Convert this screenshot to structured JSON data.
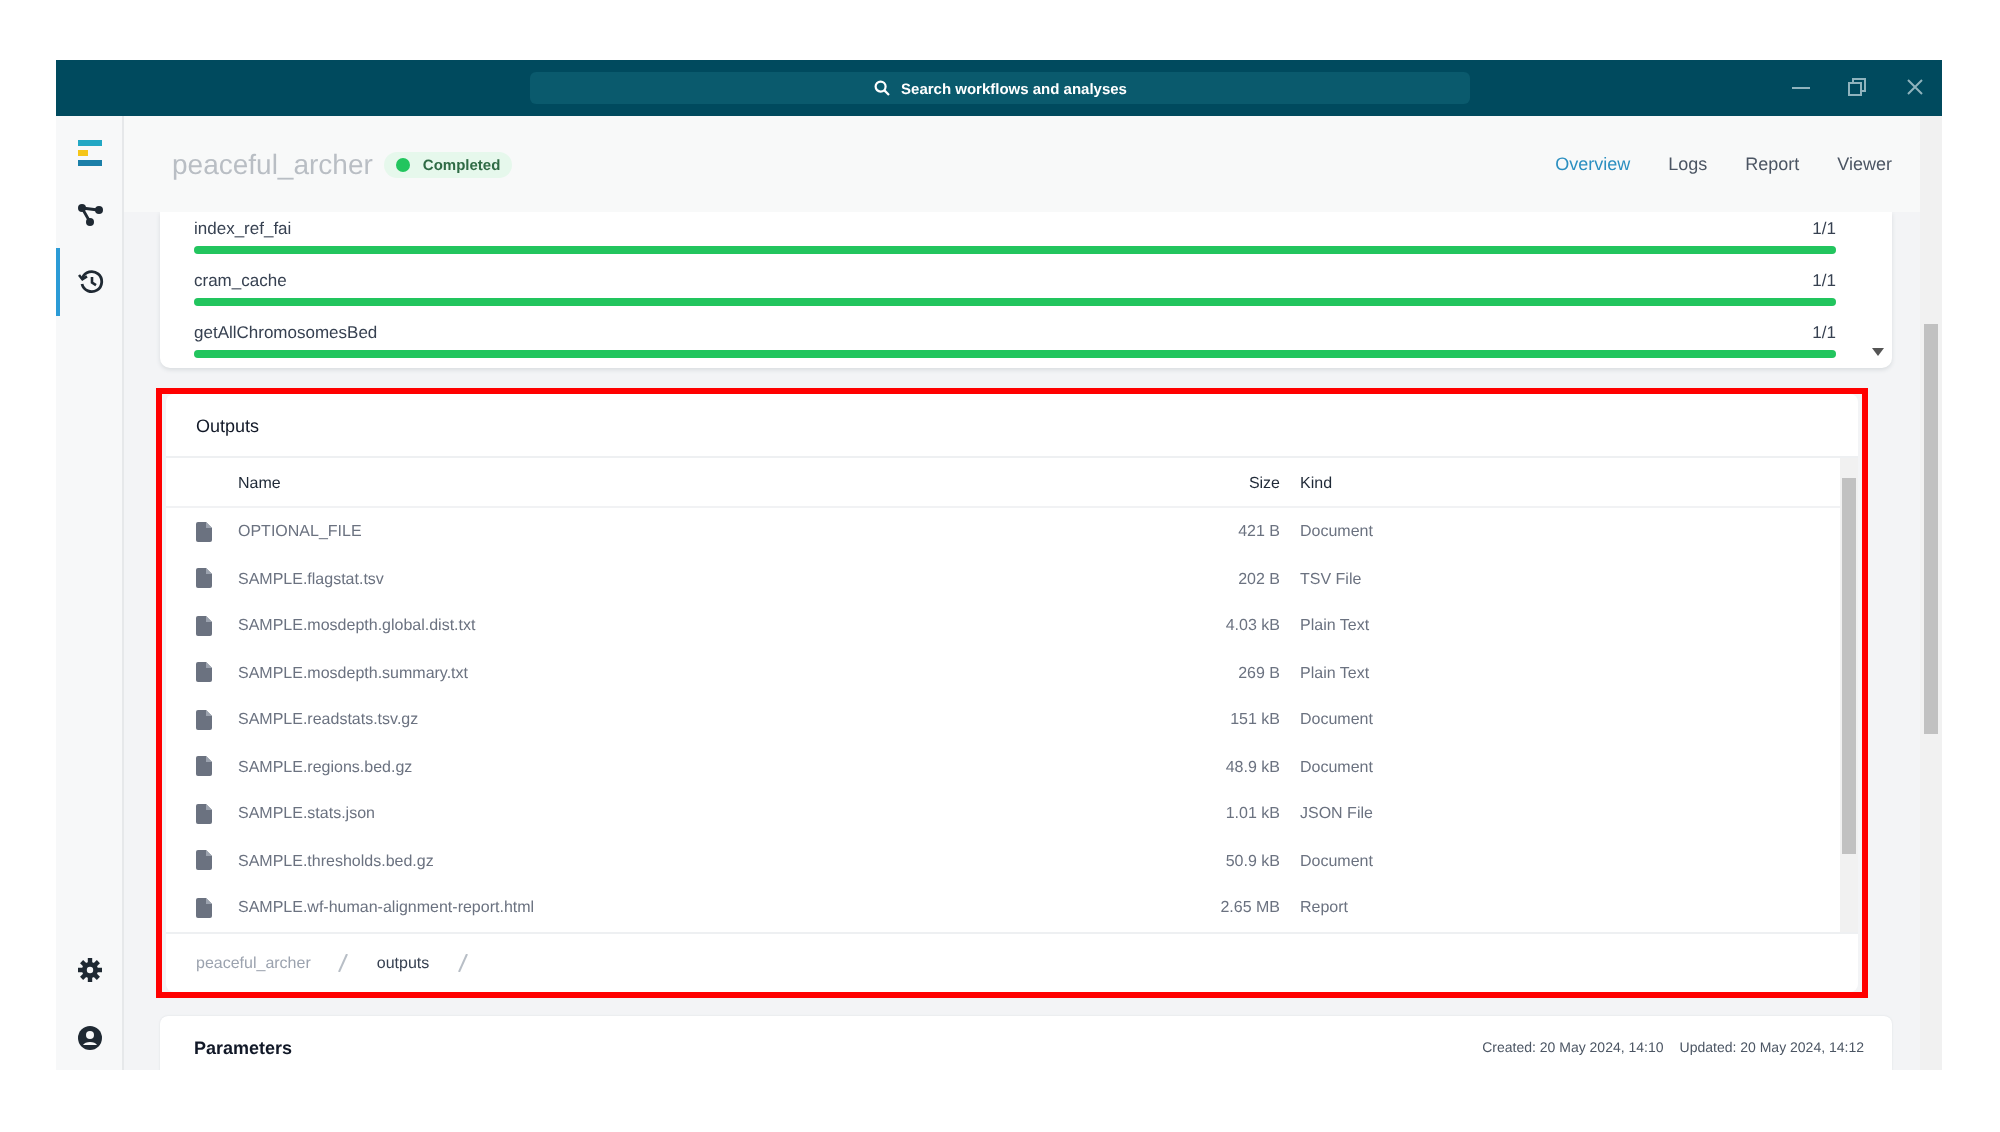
{
  "window": {
    "search_placeholder": "Search workflows and analyses"
  },
  "sidebar": {
    "items": [
      {
        "kind": "workflows",
        "selected": false
      },
      {
        "kind": "history",
        "selected": true
      }
    ]
  },
  "run": {
    "title": "peaceful_archer",
    "status": "Completed",
    "tabs": [
      {
        "label": "Overview",
        "selected": true
      },
      {
        "label": "Logs",
        "selected": false
      },
      {
        "label": "Report",
        "selected": false
      },
      {
        "label": "Viewer",
        "selected": false
      }
    ]
  },
  "progress": [
    {
      "name": "index_ref_fai",
      "count": "1/1",
      "level": 1
    },
    {
      "name": "cram_cache",
      "count": "1/1",
      "level": 1
    },
    {
      "name": "getAllChromosomesBed",
      "count": "1/1",
      "level": 1
    }
  ],
  "outputs": {
    "title": "Outputs",
    "columns": [
      "Name",
      "Size",
      "Kind"
    ],
    "rows": [
      {
        "name": "OPTIONAL_FILE",
        "size": "421 B",
        "kind": "Document"
      },
      {
        "name": "SAMPLE.flagstat.tsv",
        "size": "202 B",
        "kind": "TSV File"
      },
      {
        "name": "SAMPLE.mosdepth.global.dist.txt",
        "size": "4.03 kB",
        "kind": "Plain Text"
      },
      {
        "name": "SAMPLE.mosdepth.summary.txt",
        "size": "269 B",
        "kind": "Plain Text"
      },
      {
        "name": "SAMPLE.readstats.tsv.gz",
        "size": "151 kB",
        "kind": "Document"
      },
      {
        "name": "SAMPLE.regions.bed.gz",
        "size": "48.9 kB",
        "kind": "Document"
      },
      {
        "name": "SAMPLE.stats.json",
        "size": "1.01 kB",
        "kind": "JSON File"
      },
      {
        "name": "SAMPLE.thresholds.bed.gz",
        "size": "50.9 kB",
        "kind": "Document"
      },
      {
        "name": "SAMPLE.wf-human-alignment-report.html",
        "size": "2.65 MB",
        "kind": "Report"
      }
    ],
    "breadcrumb": [
      "peaceful_archer",
      "outputs"
    ]
  },
  "parameters": {
    "title": "Parameters",
    "created": "Created: 20 May 2024, 14:10",
    "updated": "Updated: 20 May 2024, 14:12"
  }
}
